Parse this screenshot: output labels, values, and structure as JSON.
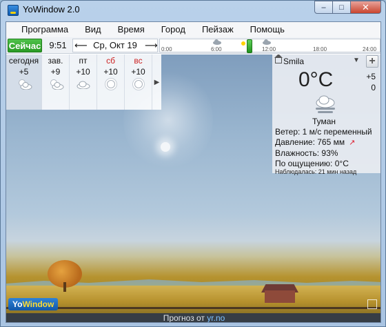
{
  "window": {
    "title": "YoWindow 2.0"
  },
  "menu": [
    "Программа",
    "Вид",
    "Время",
    "Город",
    "Пейзаж",
    "Помощь"
  ],
  "toolbar": {
    "now_label": "Сейчас",
    "time": "9:51",
    "date": "Ср, Окт 19",
    "timeline_ticks": [
      "0:00",
      "6:00",
      "12:00",
      "18:00",
      "24:00"
    ]
  },
  "forecast": [
    {
      "name": "сегодня",
      "temp": "+5",
      "icon": "partly-cloudy-icon",
      "weekend": false
    },
    {
      "name": "зав.",
      "temp": "+9",
      "icon": "partly-cloudy-icon",
      "weekend": false
    },
    {
      "name": "пт",
      "temp": "+10",
      "icon": "cloud-icon",
      "weekend": false
    },
    {
      "name": "сб",
      "temp": "+10",
      "icon": "sun-icon",
      "weekend": true
    },
    {
      "name": "вс",
      "temp": "+10",
      "icon": "sun-icon",
      "weekend": true
    }
  ],
  "current": {
    "city": "Smila",
    "temperature": "0°C",
    "high": "+5",
    "low": "0",
    "condition": "Туман",
    "condition_icon": "fog-icon",
    "wind": "Ветер:  1 м/с переменный",
    "pressure": "Давление:  765 мм",
    "humidity": "Влажность:  93%",
    "feels_like": "По ощущению:   0°C",
    "observed": "Наблюдалась:  21 мин назад"
  },
  "logo": {
    "yo": "Yo",
    "window": "Window"
  },
  "status": {
    "prefix": "Прогноз от",
    "link": "yr.no"
  },
  "colors": {
    "now_button": "#2a9a25",
    "weekend": "#cc2222",
    "status_bg": "#363d45",
    "link": "#7ec2ff"
  }
}
